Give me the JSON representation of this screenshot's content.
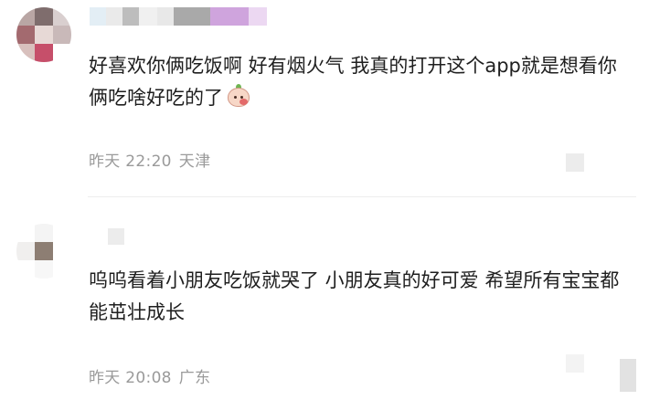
{
  "comments": [
    {
      "text": "好喜欢你俩吃饭啊 好有烟火气 我真的打开这个app就是想看你俩吃啥好吃的了",
      "emoji_icon": "peach-face-emoji",
      "time": "昨天 22:20",
      "location": "天津"
    },
    {
      "text": "呜呜看着小朋友吃饭就哭了 小朋友真的好可爱 希望所有宝宝都能茁壮成长",
      "time": "昨天 20:08",
      "location": "广东"
    }
  ],
  "colors": {
    "text": "#1f1f1f",
    "meta": "#9a9a9a",
    "divider": "#eeeeee",
    "avatar1": [
      "#b9a6a4",
      "#7f6d6d",
      "#d9cfcf",
      "#a36a6f",
      "#e7d9d6",
      "#c9b9b9",
      "#d8c0bd",
      "#c64f6a",
      "#ffffff"
    ],
    "username_strip": [
      "#e3eef5",
      "#eaeaea",
      "#bdbdbd",
      "#f0f0f0",
      "#e8e8e8",
      "#a9a9a9",
      "#cfa4dd",
      "#ecd8f2"
    ],
    "avatar2": [
      "#ffffff",
      "#f4f4f4",
      "#ffffff",
      "#f0efee",
      "#8d7e73",
      "#ffffff",
      "#ffffff",
      "#f7f7f7",
      "#ffffff"
    ]
  }
}
